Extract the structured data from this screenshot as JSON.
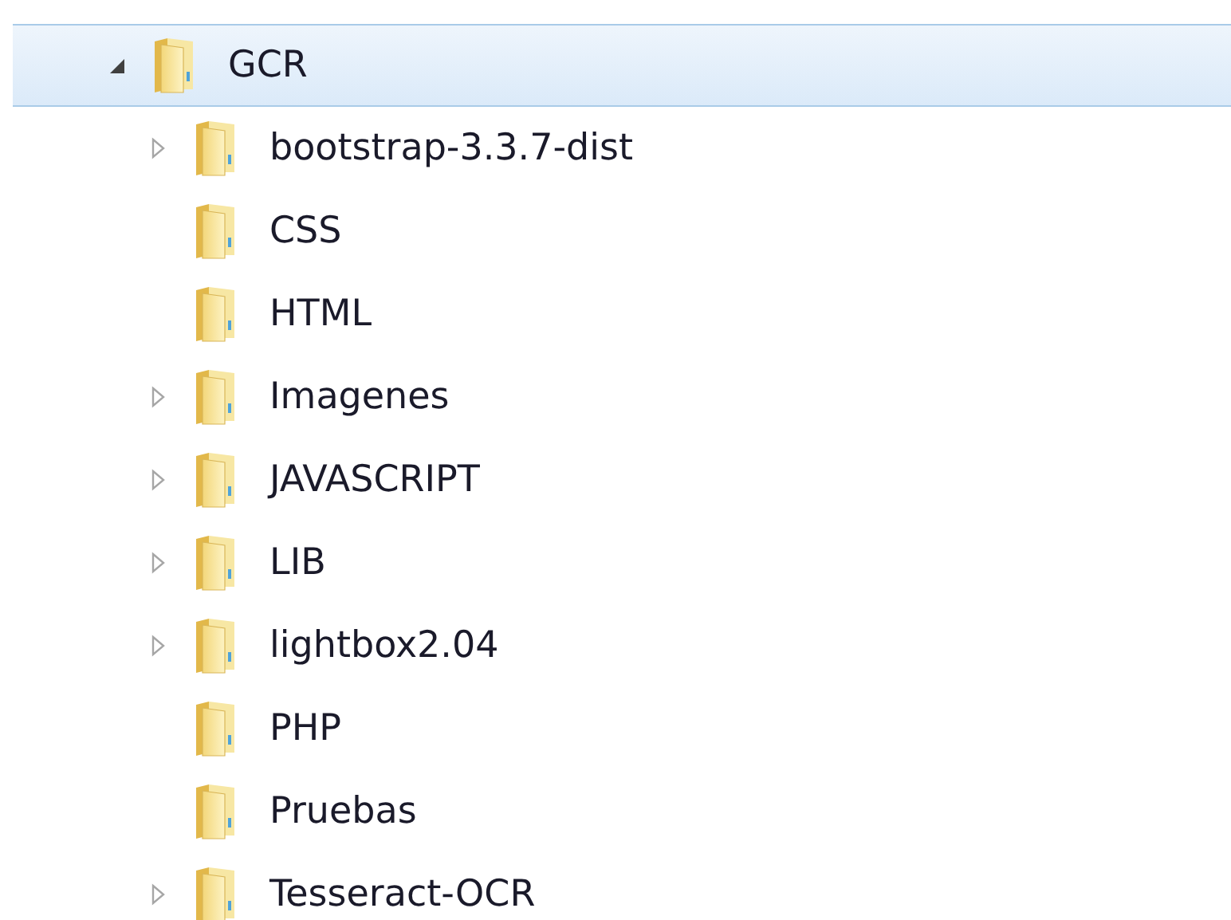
{
  "tree": [
    {
      "label": "GCR",
      "expanded": true,
      "selected": true,
      "children": [
        {
          "label": "bootstrap-3.3.7-dist",
          "expanded": false,
          "selected": false
        },
        {
          "label": "CSS",
          "selected": false
        },
        {
          "label": "HTML",
          "selected": false
        },
        {
          "label": "Imagenes",
          "expanded": false,
          "selected": false
        },
        {
          "label": "JAVASCRIPT",
          "expanded": false,
          "selected": false
        },
        {
          "label": "LIB",
          "expanded": false,
          "selected": false
        },
        {
          "label": "lightbox2.04",
          "expanded": false,
          "selected": false
        },
        {
          "label": "PHP",
          "selected": false
        },
        {
          "label": "Pruebas",
          "selected": false
        },
        {
          "label": "Tesseract-OCR",
          "expanded": false,
          "selected": false
        }
      ]
    }
  ]
}
